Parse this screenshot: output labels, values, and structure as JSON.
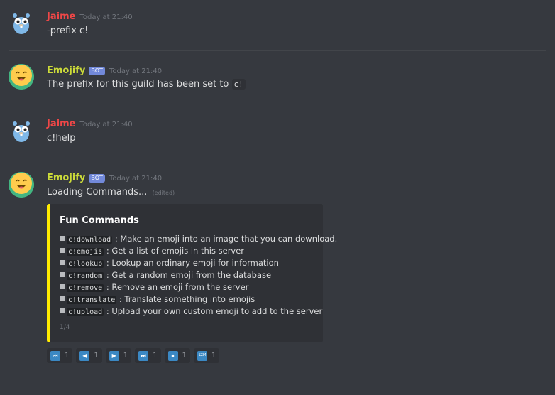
{
  "messages": [
    {
      "author": "Jaime",
      "timestamp": "Today at 21:40",
      "text": "-prefix c!"
    },
    {
      "author": "Emojify",
      "bot_tag": "BOT",
      "timestamp": "Today at 21:40",
      "text_prefix": "The prefix for this guild has been set to",
      "code": "c!"
    },
    {
      "author": "Jaime",
      "timestamp": "Today at 21:40",
      "text": "c!help"
    },
    {
      "author": "Emojify",
      "bot_tag": "BOT",
      "timestamp": "Today at 21:40",
      "text": "Loading Commands...",
      "edited": "(edited)",
      "embed": {
        "title": "Fun Commands",
        "commands": [
          {
            "cmd": "c!download",
            "desc": ": Make an emoji into an image that you can download."
          },
          {
            "cmd": "c!emojis",
            "desc": ": Get a list of emojis in this server"
          },
          {
            "cmd": "c!lookup",
            "desc": ": Lookup an ordinary emoji for information"
          },
          {
            "cmd": "c!random",
            "desc": ": Get a random emoji from the database"
          },
          {
            "cmd": "c!remove",
            "desc": ": Remove an emoji from the server"
          },
          {
            "cmd": "c!translate",
            "desc": ": Translate something into emojis"
          },
          {
            "cmd": "c!upload",
            "desc": ": Upload your own custom emoji to add to the server"
          }
        ],
        "footer": "1/4",
        "accent_color": "#ffeb00"
      },
      "reactions": [
        {
          "icon": "first-page-icon",
          "glyph": "⏮",
          "count": "1"
        },
        {
          "icon": "previous-icon",
          "glyph": "◀",
          "count": "1"
        },
        {
          "icon": "next-icon",
          "glyph": "▶",
          "count": "1"
        },
        {
          "icon": "last-page-icon",
          "glyph": "⏭",
          "count": "1"
        },
        {
          "icon": "stop-icon",
          "glyph": "⏹",
          "count": "1"
        },
        {
          "icon": "numbers-icon",
          "glyph": "1234",
          "count": "1"
        }
      ]
    }
  ]
}
